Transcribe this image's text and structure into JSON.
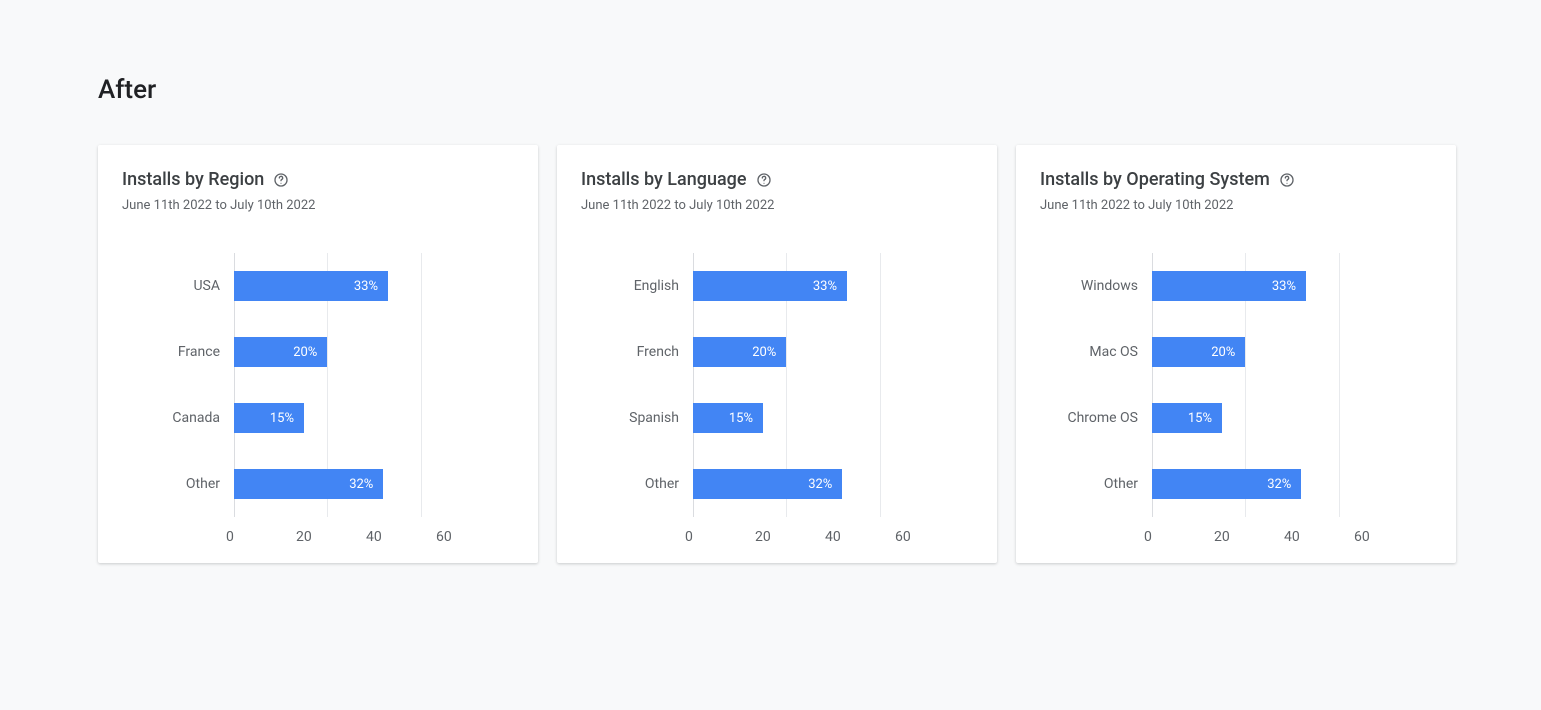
{
  "page_title": "After",
  "date_range": "June 11th 2022 to July 10th 2022",
  "axis_max": 60,
  "x_ticks": [
    "0",
    "20",
    "40",
    "60"
  ],
  "cards": [
    {
      "title": "Installs by Region",
      "series": [
        {
          "label": "USA",
          "value": 33,
          "display": "33%"
        },
        {
          "label": "France",
          "value": 20,
          "display": "20%"
        },
        {
          "label": "Canada",
          "value": 15,
          "display": "15%"
        },
        {
          "label": "Other",
          "value": 32,
          "display": "32%"
        }
      ]
    },
    {
      "title": "Installs by Language",
      "series": [
        {
          "label": "English",
          "value": 33,
          "display": "33%"
        },
        {
          "label": "French",
          "value": 20,
          "display": "20%"
        },
        {
          "label": "Spanish",
          "value": 15,
          "display": "15%"
        },
        {
          "label": "Other",
          "value": 32,
          "display": "32%"
        }
      ]
    },
    {
      "title": "Installs by Operating System",
      "series": [
        {
          "label": "Windows",
          "value": 33,
          "display": "33%"
        },
        {
          "label": "Mac OS",
          "value": 20,
          "display": "20%"
        },
        {
          "label": "Chrome OS",
          "value": 15,
          "display": "15%"
        },
        {
          "label": "Other",
          "value": 32,
          "display": "32%"
        }
      ]
    }
  ],
  "chart_data": [
    {
      "type": "bar",
      "orientation": "horizontal",
      "title": "Installs by Region",
      "categories": [
        "USA",
        "France",
        "Canada",
        "Other"
      ],
      "values": [
        33,
        20,
        15,
        32
      ],
      "xlabel": "",
      "ylabel": "",
      "xlim": [
        0,
        60
      ]
    },
    {
      "type": "bar",
      "orientation": "horizontal",
      "title": "Installs by Language",
      "categories": [
        "English",
        "French",
        "Spanish",
        "Other"
      ],
      "values": [
        33,
        20,
        15,
        32
      ],
      "xlabel": "",
      "ylabel": "",
      "xlim": [
        0,
        60
      ]
    },
    {
      "type": "bar",
      "orientation": "horizontal",
      "title": "Installs by Operating System",
      "categories": [
        "Windows",
        "Mac OS",
        "Chrome OS",
        "Other"
      ],
      "values": [
        33,
        20,
        15,
        32
      ],
      "xlabel": "",
      "ylabel": "",
      "xlim": [
        0,
        60
      ]
    }
  ]
}
